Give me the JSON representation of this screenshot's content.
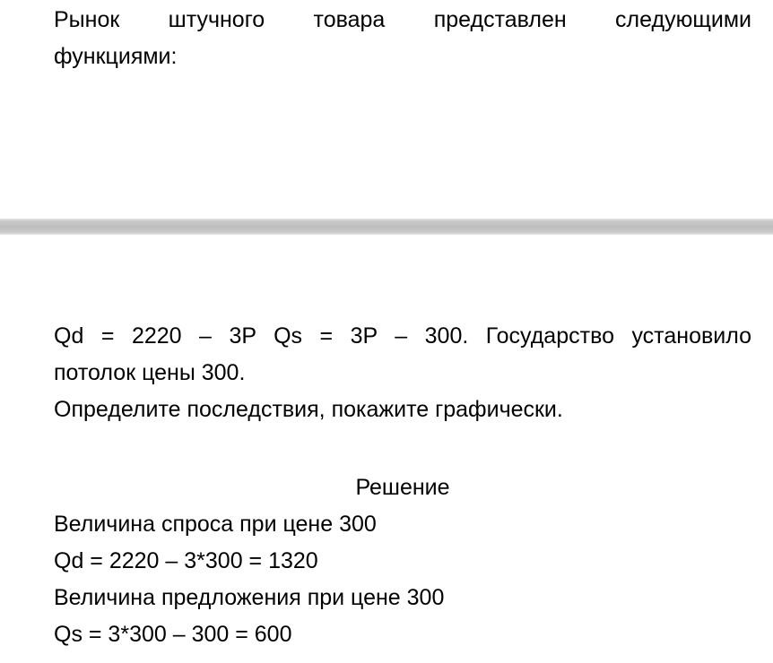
{
  "page1": {
    "problem_line1": "Рынок штучного товара представлен следующими",
    "problem_line2": "функциями:"
  },
  "page2": {
    "functions_line1": "Qd = 2220 – 3P Qs = 3P – 300. Государство установило",
    "functions_line2": "потолок цены 300.",
    "task": "Определите последствия, покажите графически.",
    "solution_heading": "Решение",
    "solution_lines": [
      "Величина спроса при цене 300",
      "Qd = 2220 – 3*300 = 1320",
      "Величина предложения при цене 300",
      "Qs = 3*300 – 300 = 600"
    ]
  }
}
